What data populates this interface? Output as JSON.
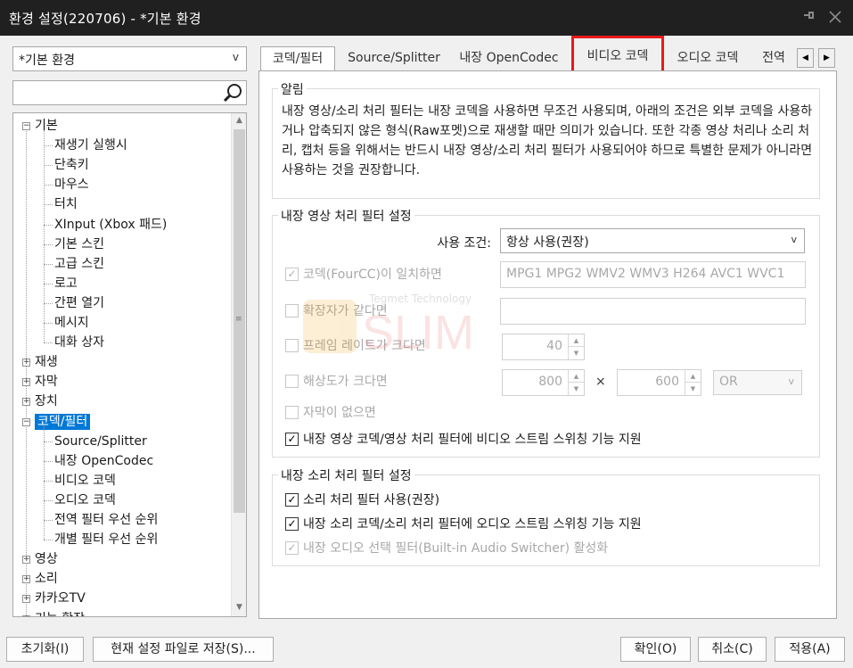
{
  "window": {
    "title": "환경 설정(220706) - *기본 환경",
    "pin_icon": "pin-icon",
    "close_icon": "close-icon"
  },
  "left": {
    "preset": {
      "value": "*기본 환경",
      "arrow": "v"
    },
    "search": {
      "value": "",
      "icon": "search-icon"
    },
    "tree": [
      {
        "label": "기본",
        "level": 0,
        "toggle": "−"
      },
      {
        "label": "재생기 실행시",
        "level": 1
      },
      {
        "label": "단축키",
        "level": 1
      },
      {
        "label": "마우스",
        "level": 1
      },
      {
        "label": "터치",
        "level": 1
      },
      {
        "label": "XInput (Xbox 패드)",
        "level": 1
      },
      {
        "label": "기본 스킨",
        "level": 1
      },
      {
        "label": "고급 스킨",
        "level": 1
      },
      {
        "label": "로고",
        "level": 1
      },
      {
        "label": "간편 열기",
        "level": 1
      },
      {
        "label": "메시지",
        "level": 1
      },
      {
        "label": "대화 상자",
        "level": 1
      },
      {
        "label": "재생",
        "level": 0,
        "toggle": "+"
      },
      {
        "label": "자막",
        "level": 0,
        "toggle": "+"
      },
      {
        "label": "장치",
        "level": 0,
        "toggle": "+"
      },
      {
        "label": "코덱/필터",
        "level": 0,
        "toggle": "−",
        "selected": true
      },
      {
        "label": "Source/Splitter",
        "level": 1
      },
      {
        "label": "내장 OpenCodec",
        "level": 1
      },
      {
        "label": "비디오 코덱",
        "level": 1
      },
      {
        "label": "오디오 코덱",
        "level": 1
      },
      {
        "label": "전역 필터 우선 순위",
        "level": 1
      },
      {
        "label": "개별 필터 우선 순위",
        "level": 1
      },
      {
        "label": "영상",
        "level": 0,
        "toggle": "+"
      },
      {
        "label": "소리",
        "level": 0,
        "toggle": "+"
      },
      {
        "label": "카카오TV",
        "level": 0,
        "toggle": "+"
      },
      {
        "label": "기능 확장",
        "level": 0,
        "toggle": "+"
      }
    ]
  },
  "tabs": [
    {
      "label": "코덱/필터",
      "active": true
    },
    {
      "label": "Source/Splitter"
    },
    {
      "label": "내장 OpenCodec"
    },
    {
      "label": "비디오 코덱",
      "highlighted": true
    },
    {
      "label": "오디오 코덱"
    },
    {
      "label": "전역"
    }
  ],
  "tab_scroll": {
    "left": "◀",
    "right": "▶"
  },
  "notice": {
    "title": "알림",
    "text": "내장 영상/소리 처리 필터는 내장 코덱을 사용하면 무조건 사용되며, 아래의 조건은 외부 코덱을 사용하거나 압축되지 않은 형식(Raw포멧)으로 재생할 때만 의미가 있습니다. 또한 각종 영상 처리나 소리 처리, 캡처 등을 위해서는 반드시 내장 영상/소리 처리 필터가 사용되어야 하므로 특별한 문제가 아니라면 사용하는 것을 권장합니다."
  },
  "video_filter": {
    "title": "내장 영상 처리 필터 설정",
    "condition_label": "사용 조건:",
    "condition_value": "항상 사용(권장)",
    "condition_arrow": "v",
    "fourcc": {
      "label": "코덱(FourCC)이 일치하면",
      "checked": true,
      "value": "MPG1 MPG2 WMV2 WMV3 H264 AVC1 WVC1"
    },
    "ext": {
      "label": "확장자가 같다면",
      "checked": false,
      "value": ""
    },
    "framerate": {
      "label": "프레임 레이트가 크다면",
      "checked": false,
      "value": "40"
    },
    "resolution": {
      "label": "해상도가 크다면",
      "checked": false,
      "width": "800",
      "height": "600",
      "times": "×",
      "op": "OR",
      "op_arrow": "v"
    },
    "nosub": {
      "label": "자막이 없으면",
      "checked": false
    },
    "switching": {
      "label": "내장 영상 코덱/영상 처리 필터에 비디오 스트림 스위칭 기능 지원",
      "checked": true
    }
  },
  "audio_filter": {
    "title": "내장 소리 처리 필터 설정",
    "use": {
      "label": "소리 처리 필터 사용(권장)",
      "checked": true
    },
    "switching": {
      "label": "내장 소리 코덱/소리 처리 필터에 오디오 스트림 스위칭 기능 지원",
      "checked": true
    },
    "selector": {
      "label": "내장 오디오 선택 필터(Built-in Audio Switcher) 활성화",
      "checked": true
    }
  },
  "watermark": {
    "line1": "Tegmet Technology",
    "line2": "SLIM"
  },
  "buttons": {
    "reset": "초기화(I)",
    "save_file": "현재 설정 파일로 저장(S)...",
    "ok": "확인(O)",
    "cancel": "취소(C)",
    "apply": "적용(A)"
  },
  "colors": {
    "selection": "#0078d7",
    "highlight_box": "#e81a1a",
    "titlebar": "#202020"
  }
}
